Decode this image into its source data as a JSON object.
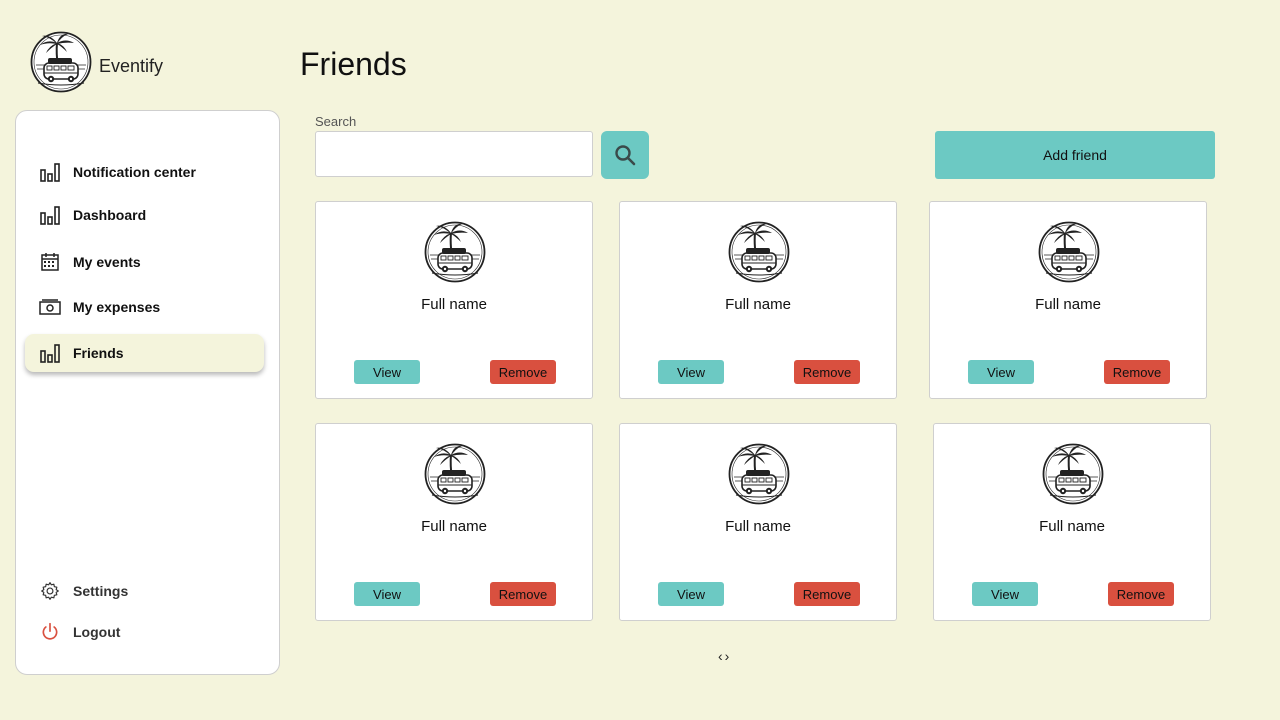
{
  "brand": {
    "name": "Eventify",
    "logo_icon": "van-palm-logo"
  },
  "sidebar": {
    "items": [
      {
        "label": "Notification center",
        "icon": "bar-chart-icon"
      },
      {
        "label": "Dashboard",
        "icon": "bar-chart-icon"
      },
      {
        "label": "My events",
        "icon": "calendar-icon"
      },
      {
        "label": "My expenses",
        "icon": "cash-icon"
      },
      {
        "label": "Friends",
        "icon": "bar-chart-icon",
        "active": true
      }
    ],
    "bottom": [
      {
        "label": "Settings",
        "icon": "gear-icon"
      },
      {
        "label": "Logout",
        "icon": "power-icon"
      }
    ]
  },
  "page": {
    "title": "Friends"
  },
  "search": {
    "label": "Search",
    "value": "",
    "placeholder": ""
  },
  "actions": {
    "add_friend": "Add friend"
  },
  "friends": [
    {
      "name": "Full name",
      "view": "View",
      "remove": "Remove"
    },
    {
      "name": "Full name",
      "view": "View",
      "remove": "Remove"
    },
    {
      "name": "Full name",
      "view": "View",
      "remove": "Remove"
    },
    {
      "name": "Full name",
      "view": "View",
      "remove": "Remove"
    },
    {
      "name": "Full name",
      "view": "View",
      "remove": "Remove"
    },
    {
      "name": "Full name",
      "view": "View",
      "remove": "Remove"
    }
  ],
  "pagination": {
    "prev": "‹",
    "next": "›"
  },
  "colors": {
    "background": "#f4f4dc",
    "accent": "#6cc9c3",
    "danger": "#d9503f",
    "logout_icon": "#d9503f"
  }
}
